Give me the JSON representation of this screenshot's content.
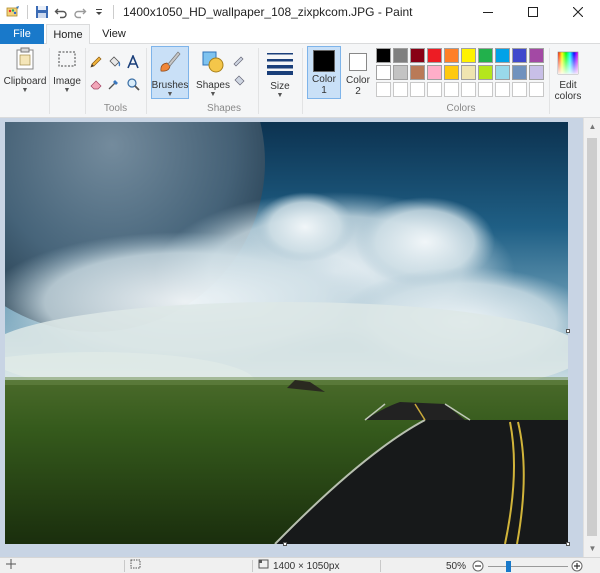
{
  "window": {
    "title": "1400x1050_HD_wallpaper_108_zixpkcom.JPG - Paint"
  },
  "tabs": [
    {
      "label": "File"
    },
    {
      "label": "Home"
    },
    {
      "label": "View"
    }
  ],
  "ribbon": {
    "clipboard": {
      "label": "Clipboard"
    },
    "image": {
      "label": "Image"
    },
    "tools": {
      "label": "Tools"
    },
    "brushes": {
      "label": "Brushes"
    },
    "shapes_btn": {
      "label": "Shapes"
    },
    "shapes_group": {
      "label": "Shapes"
    },
    "size": {
      "label": "Size"
    },
    "color1": {
      "label_line1": "Color",
      "label_line2": "1",
      "value": "#000000"
    },
    "color2": {
      "label_line1": "Color",
      "label_line2": "2",
      "value": "#ffffff"
    },
    "colors_group": {
      "label": "Colors"
    },
    "edit_colors": {
      "label_line1": "Edit",
      "label_line2": "colors"
    },
    "palette_row1": [
      "#000000",
      "#7f7f7f",
      "#880015",
      "#ed1c24",
      "#ff7f27",
      "#fff200",
      "#22b14c",
      "#00a2e8",
      "#3f48cc",
      "#a349a4"
    ],
    "palette_row2": [
      "#ffffff",
      "#c3c3c3",
      "#b97a57",
      "#ffaec9",
      "#ffc90e",
      "#efe4b0",
      "#b5e61d",
      "#99d9ea",
      "#7092be",
      "#c8bfe7"
    ]
  },
  "status": {
    "image_size": "1400 × 1050px",
    "zoom": "50%",
    "zoom_level": 0.5
  }
}
